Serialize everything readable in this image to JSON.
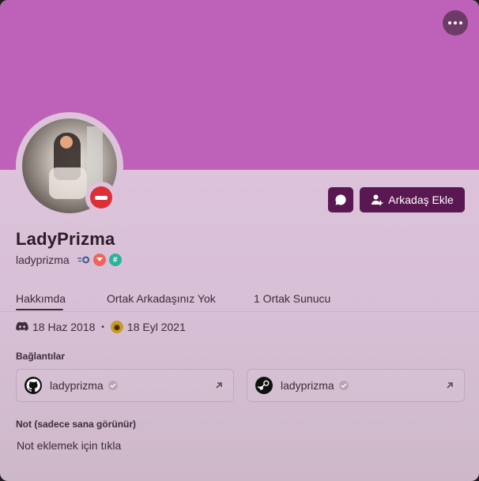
{
  "profile": {
    "display_name": "LadyPrizma",
    "username": "ladyprizma",
    "status": "do-not-disturb",
    "banner_color": "#bd62b8",
    "accent_color": "#5a1852",
    "avatar_alt": "profile photo"
  },
  "actions": {
    "add_friend_label": "Arkadaş Ekle",
    "message_icon": "chat-bubble-icon",
    "more_icon": "ellipsis-icon"
  },
  "badges": [
    {
      "icon": "hypesquad-icon"
    },
    {
      "icon": "nitro-icon"
    },
    {
      "icon": "hashtag-icon"
    }
  ],
  "tabs": [
    {
      "label": "Hakkımda",
      "active": true
    },
    {
      "label": "Ortak Arkadaşınız Yok",
      "active": false
    },
    {
      "label": "1 Ortak Sunucu",
      "active": false
    }
  ],
  "dates": {
    "discord_member_since": "18 Haz 2018",
    "server_member_since": "18 Eyl 2021"
  },
  "connections": {
    "title": "Bağlantılar",
    "items": [
      {
        "service": "github",
        "name": "ladyprizma",
        "verified": true
      },
      {
        "service": "steam",
        "name": "ladyprizma",
        "verified": true
      }
    ]
  },
  "note": {
    "title": "Not (sadece sana görünür)",
    "placeholder": "Not eklemek için tıkla"
  }
}
